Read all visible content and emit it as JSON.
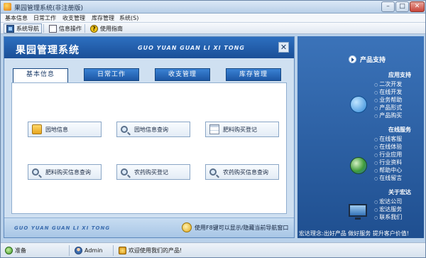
{
  "window": {
    "title": "果园管理系统(非注册版)",
    "controls": {
      "minimize": "–",
      "maximize": "□",
      "close": "✕"
    }
  },
  "menubar": {
    "items": [
      {
        "label": "基本信息"
      },
      {
        "label": "日常工作"
      },
      {
        "label": "收支管理"
      },
      {
        "label": "库存管理"
      },
      {
        "label": "系统(S)"
      }
    ]
  },
  "toolbar": {
    "nav_label": "系统导航",
    "info_label": "信息操作",
    "help_label": "使用指南",
    "help_glyph": "?"
  },
  "main": {
    "title": "果园管理系统",
    "subtitle": "GUO YUAN GUAN LI XI TONG",
    "close_glyph": "✕",
    "tabs": [
      {
        "label": "基本信息"
      },
      {
        "label": "日常工作"
      },
      {
        "label": "收支管理"
      },
      {
        "label": "库存管理"
      }
    ],
    "active_tab": "基本信息",
    "tiles": [
      {
        "label": "园地信息",
        "icon": "folder-icon"
      },
      {
        "label": "园地信息查询",
        "icon": "search-icon"
      },
      {
        "label": "肥料购买登记",
        "icon": "document-icon"
      },
      {
        "label": "肥料购买信息查询",
        "icon": "search-icon"
      },
      {
        "label": "农药购买登记",
        "icon": "search-icon"
      },
      {
        "label": "农药购买信息查询",
        "icon": "search-icon"
      }
    ],
    "footer_left": "GUO YUAN GUAN LI XI TONG",
    "footer_hint": "使用F8键可以显示/隐藏当前导航窗口"
  },
  "support": {
    "title": "产品支持",
    "sections": [
      {
        "heading": "应用支持",
        "items": [
          "二次开发",
          "在线开发",
          "业务帮助",
          "产品形式",
          "产品购买"
        ]
      },
      {
        "heading": "在线服务",
        "items": [
          "在线客服",
          "在线体验",
          "行业应用",
          "行业资料",
          "帮助中心",
          "在线留言"
        ]
      },
      {
        "heading": "关于宏达",
        "items": [
          "宏达公司",
          "宏达服务",
          "联系我们"
        ]
      }
    ],
    "slogan": "宏达理念:出好产品 做好服务 提升客户价值!"
  },
  "statusbar": {
    "ready": "准备",
    "user": "Admin",
    "welcome": "欢迎使用我们的产品!"
  },
  "colors": {
    "accent": "#1a4f97",
    "panel_bg": "#cfe0f1",
    "right_panel": "#2a5fa4"
  }
}
